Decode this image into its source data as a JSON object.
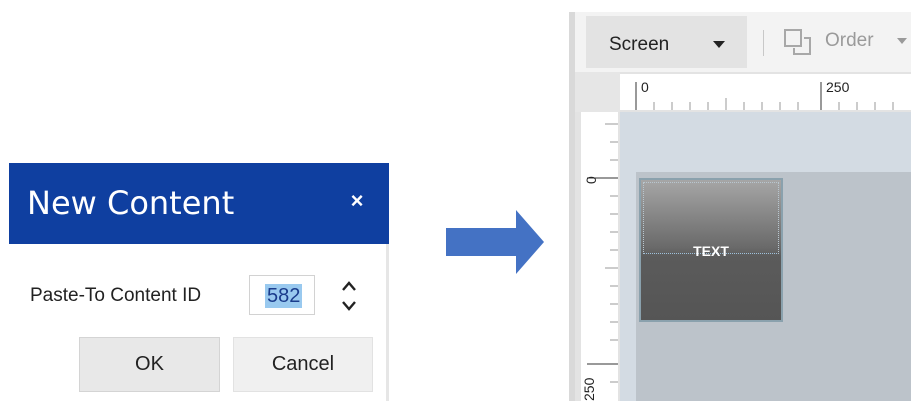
{
  "dialog": {
    "title": "New Content",
    "close_glyph": "×",
    "field_label": "Paste-To Content ID",
    "content_id": "582",
    "ok_label": "OK",
    "cancel_label": "Cancel",
    "header_color": "#0f3fa0",
    "selection_color": "#99c9ef"
  },
  "arrow": {
    "icon": "right-arrow-icon",
    "color": "#4472c4"
  },
  "editor": {
    "toolbar": {
      "screen_label": "Screen",
      "order_label": "Order"
    },
    "ruler": {
      "h_ticks": [
        "0",
        "250"
      ],
      "v_ticks": [
        "0",
        "250"
      ]
    },
    "canvas": {
      "widget_text": "TEXT"
    }
  }
}
